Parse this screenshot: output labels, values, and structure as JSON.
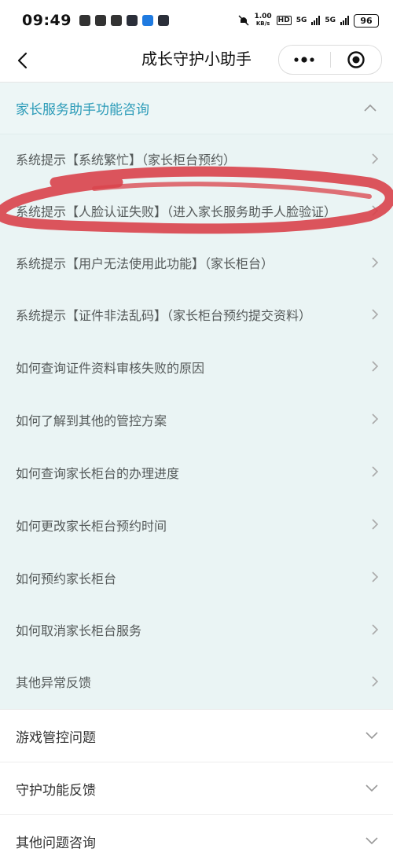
{
  "status_bar": {
    "time": "09:49",
    "net_speed_value": "1.00",
    "net_speed_unit": "KB/s",
    "hd_label": "HD",
    "signal1": "5G",
    "signal2": "5G",
    "battery": "96"
  },
  "nav": {
    "title": "成长守护小助手",
    "more_icon": "more-dots-icon",
    "close_icon": "target-close-icon"
  },
  "section": {
    "title": "家长服务助手功能咨询",
    "items": [
      "系统提示【系统繁忙】（家长柜台预约）",
      "系统提示【人脸认证失败】（进入家长服务助手人脸验证）",
      "系统提示【用户无法使用此功能】（家长柜台）",
      "系统提示【证件非法乱码】（家长柜台预约提交资料）",
      "如何查询证件资料审核失败的原因",
      "如何了解到其他的管控方案",
      "如何查询家长柜台的办理进度",
      "如何更改家长柜台预约时间",
      "如何预约家长柜台",
      "如何取消家长柜台服务",
      "其他异常反馈"
    ]
  },
  "groups": [
    "游戏管控问题",
    "守护功能反馈",
    "其他问题咨询"
  ],
  "colors": {
    "accent": "#2b9bb8",
    "section_bg": "#eaf4f4",
    "annotation": "#d9434b"
  }
}
